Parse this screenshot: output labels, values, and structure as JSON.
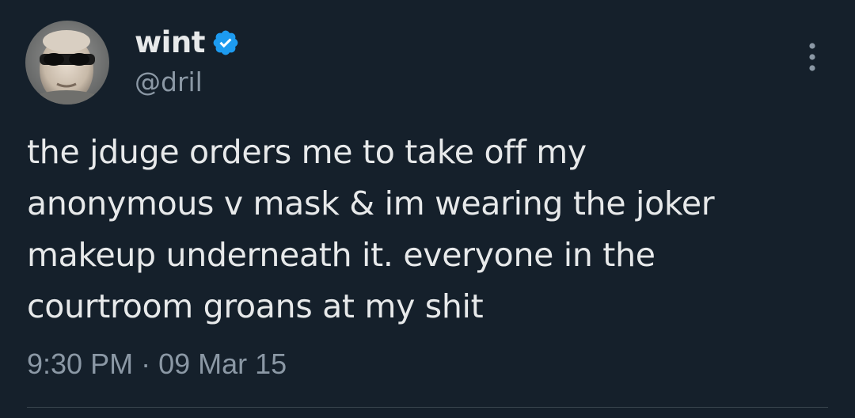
{
  "author": {
    "display_name": "wint",
    "handle": "@dril",
    "verified": true
  },
  "tweet": {
    "text": "the jduge orders me to take off my\nanonymous v mask & im wearing the joker\nmakeup underneath it. everyone in the\ncourtroom groans at my shit",
    "time": "9:30 PM",
    "separator": "·",
    "date": "09 Mar 15"
  },
  "icons": {
    "verified": "verified-badge-icon",
    "more": "more-dots-icon"
  },
  "colors": {
    "background": "#15202b",
    "primary_text": "#e7e9ea",
    "secondary_text": "#8b98a5",
    "verified_blue": "#1d9bf0",
    "divider": "#38444d"
  }
}
